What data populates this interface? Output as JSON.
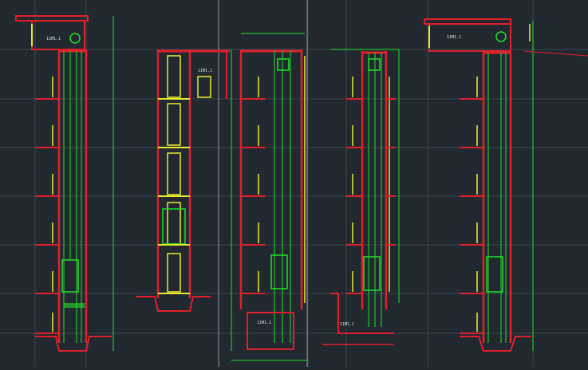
{
  "drawing": {
    "colors": {
      "background": "#212830",
      "grid": "#3a434d",
      "axis_gray": "#8f969c",
      "wall_red": "#e0202a",
      "rail_green": "#1fe12a",
      "door_yellow": "#e8ea2b",
      "text_white": "#dfe6ea"
    },
    "labels": {
      "machine_room_left": "11M1.1",
      "machine_room_right": "11M1.1",
      "machine_room_mid": "11M1.1",
      "pit_mid": "11M1.1",
      "pit_right": "11M1.1"
    }
  }
}
